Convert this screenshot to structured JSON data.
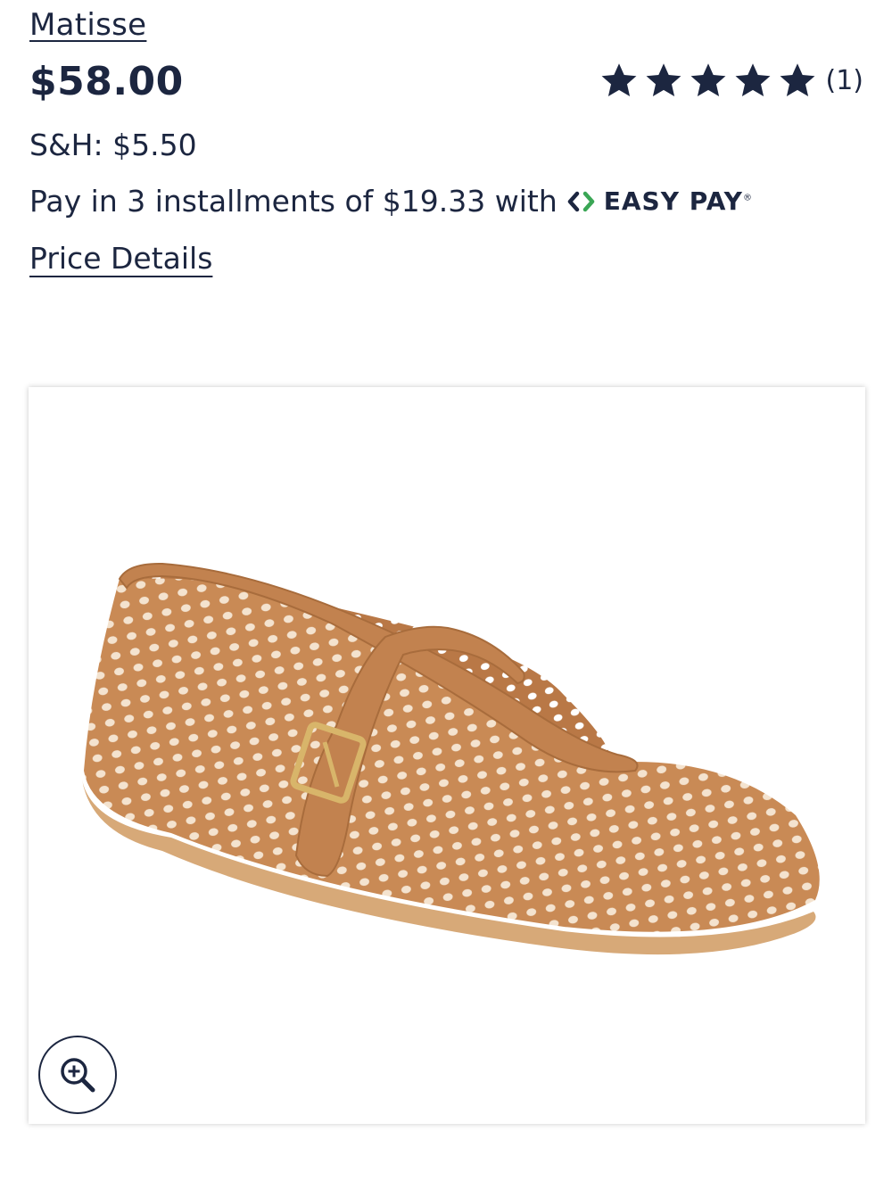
{
  "product": {
    "brand": "Matisse",
    "price": "$58.00",
    "shipping": "S&H: $5.50",
    "installments_text": "Pay in 3 installments of $19.33 with",
    "easy_pay_label": "EASY PAY",
    "easy_pay_trademark": "®",
    "price_details_link": "Price Details"
  },
  "rating": {
    "stars": 5,
    "max_stars": 5,
    "review_count": "(1)"
  },
  "image": {
    "zoom_icon": "zoom-in-icon"
  },
  "colors": {
    "text": "#1c2640",
    "easy_pay_green": "#3aa655",
    "shoe_tan": "#c98a55",
    "shoe_strap": "#c2824f",
    "buckle_gold": "#d8b56a"
  }
}
